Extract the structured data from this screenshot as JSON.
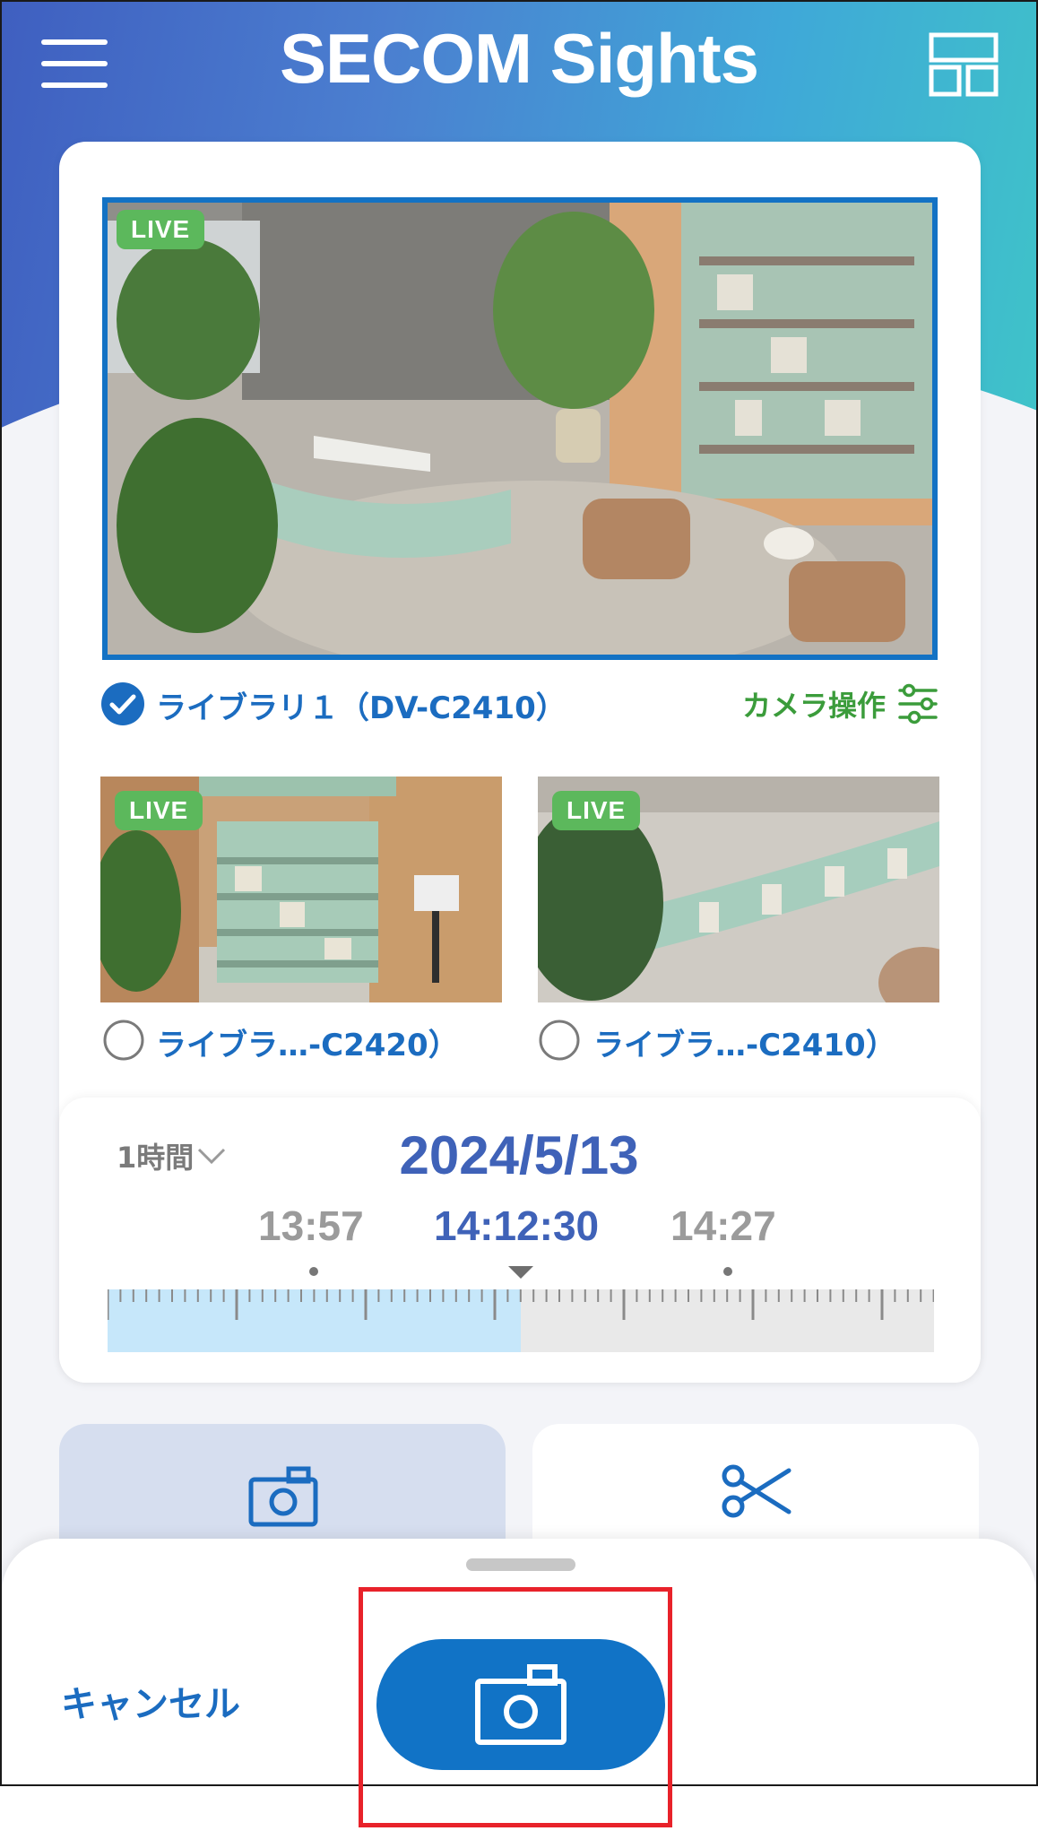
{
  "header": {
    "title": "SECOM Sights"
  },
  "main_camera": {
    "live_label": "LIVE",
    "name": "ライブラリ１（DV-C2410）",
    "selected": true,
    "camera_op_label": "カメラ操作"
  },
  "thumbnails": [
    {
      "live_label": "LIVE",
      "name": "ライブラ…-C2420）",
      "selected": false
    },
    {
      "live_label": "LIVE",
      "name": "ライブラ…-C2410）",
      "selected": false
    }
  ],
  "timeline": {
    "range": "1時間",
    "date": "2024/5/13",
    "time_left": "13:57",
    "time_current": "14:12:30",
    "time_right": "14:27",
    "played_fraction": 0.5
  },
  "actions": {
    "snapshot_icon": "camera-icon",
    "clip_icon": "scissors-icon"
  },
  "sheet": {
    "cancel_label": "キャンセル",
    "capture_icon": "camera-icon"
  },
  "colors": {
    "accent": "#1173c6",
    "live_badge": "#5cb85c",
    "camera_op": "#3b9c3b",
    "date": "#3f62b8",
    "highlight": "#e8222a"
  }
}
